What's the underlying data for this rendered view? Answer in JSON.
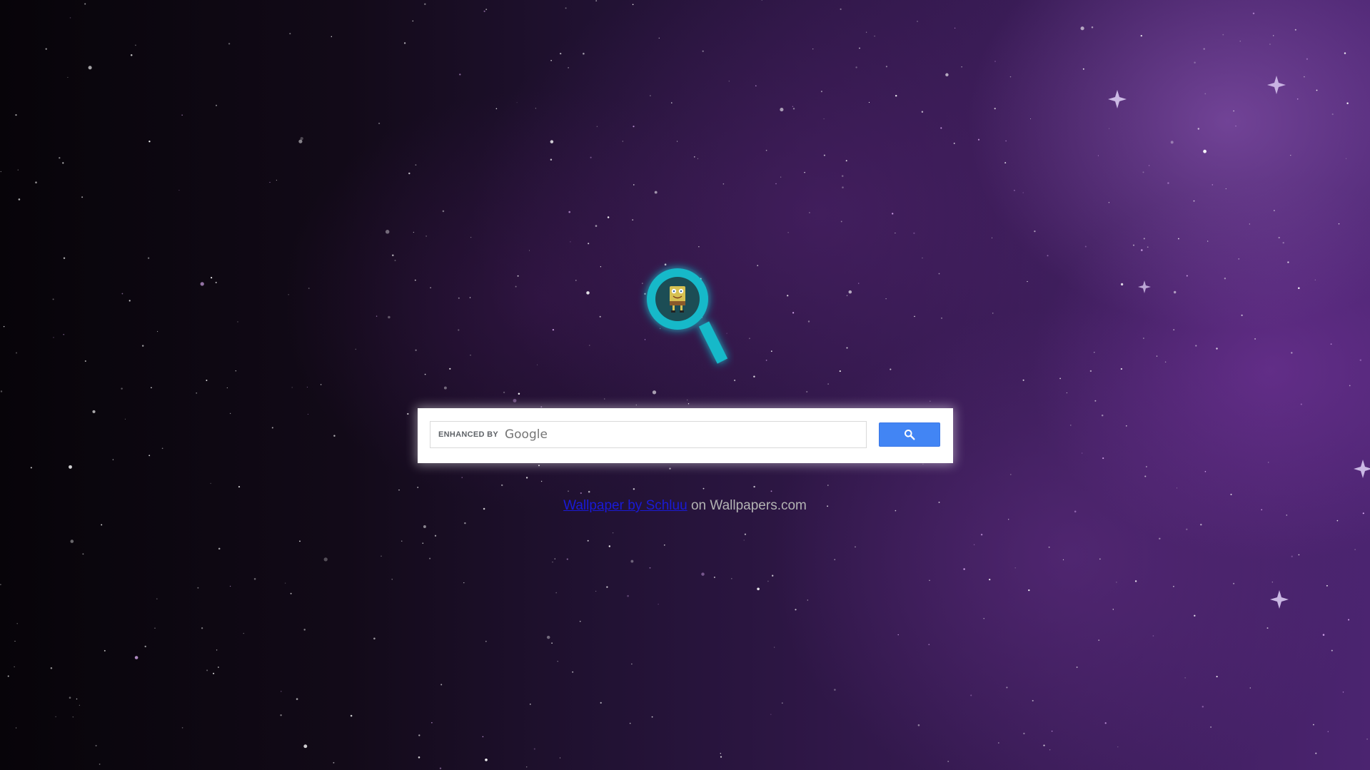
{
  "search": {
    "enhanced_by_label": "ENHANCED BY",
    "provider_label": "Google",
    "query_value": "",
    "button_icon": "search-icon"
  },
  "logo": {
    "icon": "magnifier-spongebob-icon",
    "color": "#18b9c9"
  },
  "credit": {
    "link_text": "Wallpaper by Schluu",
    "suffix_text": " on Wallpapers.com"
  },
  "colors": {
    "search_button": "#4285f4",
    "link": "#1a1ad6",
    "accent": "#18b9c9"
  }
}
